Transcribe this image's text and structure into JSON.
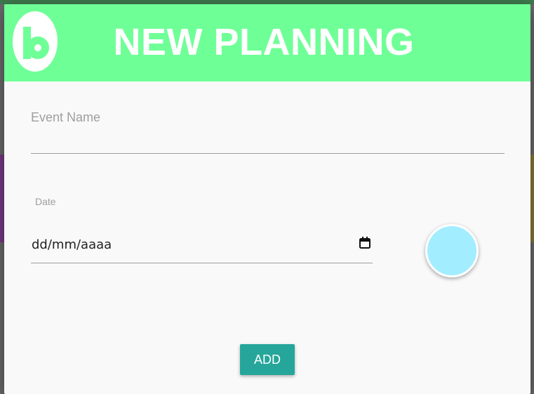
{
  "dialog": {
    "title": "NEW PLANNING",
    "brand": {
      "logo_icon": "letter-b-logo-icon",
      "accent_color": "#6fff97"
    }
  },
  "form": {
    "event_name": {
      "label": "Event Name",
      "value": ""
    },
    "date": {
      "label": "Date",
      "value_placeholder": "dd/mm/aaaa",
      "icon": "calendar-icon"
    },
    "color_picker": {
      "selected_color": "#a2edff"
    }
  },
  "actions": {
    "add_label": "ADD",
    "add_color": "#26a69a"
  }
}
